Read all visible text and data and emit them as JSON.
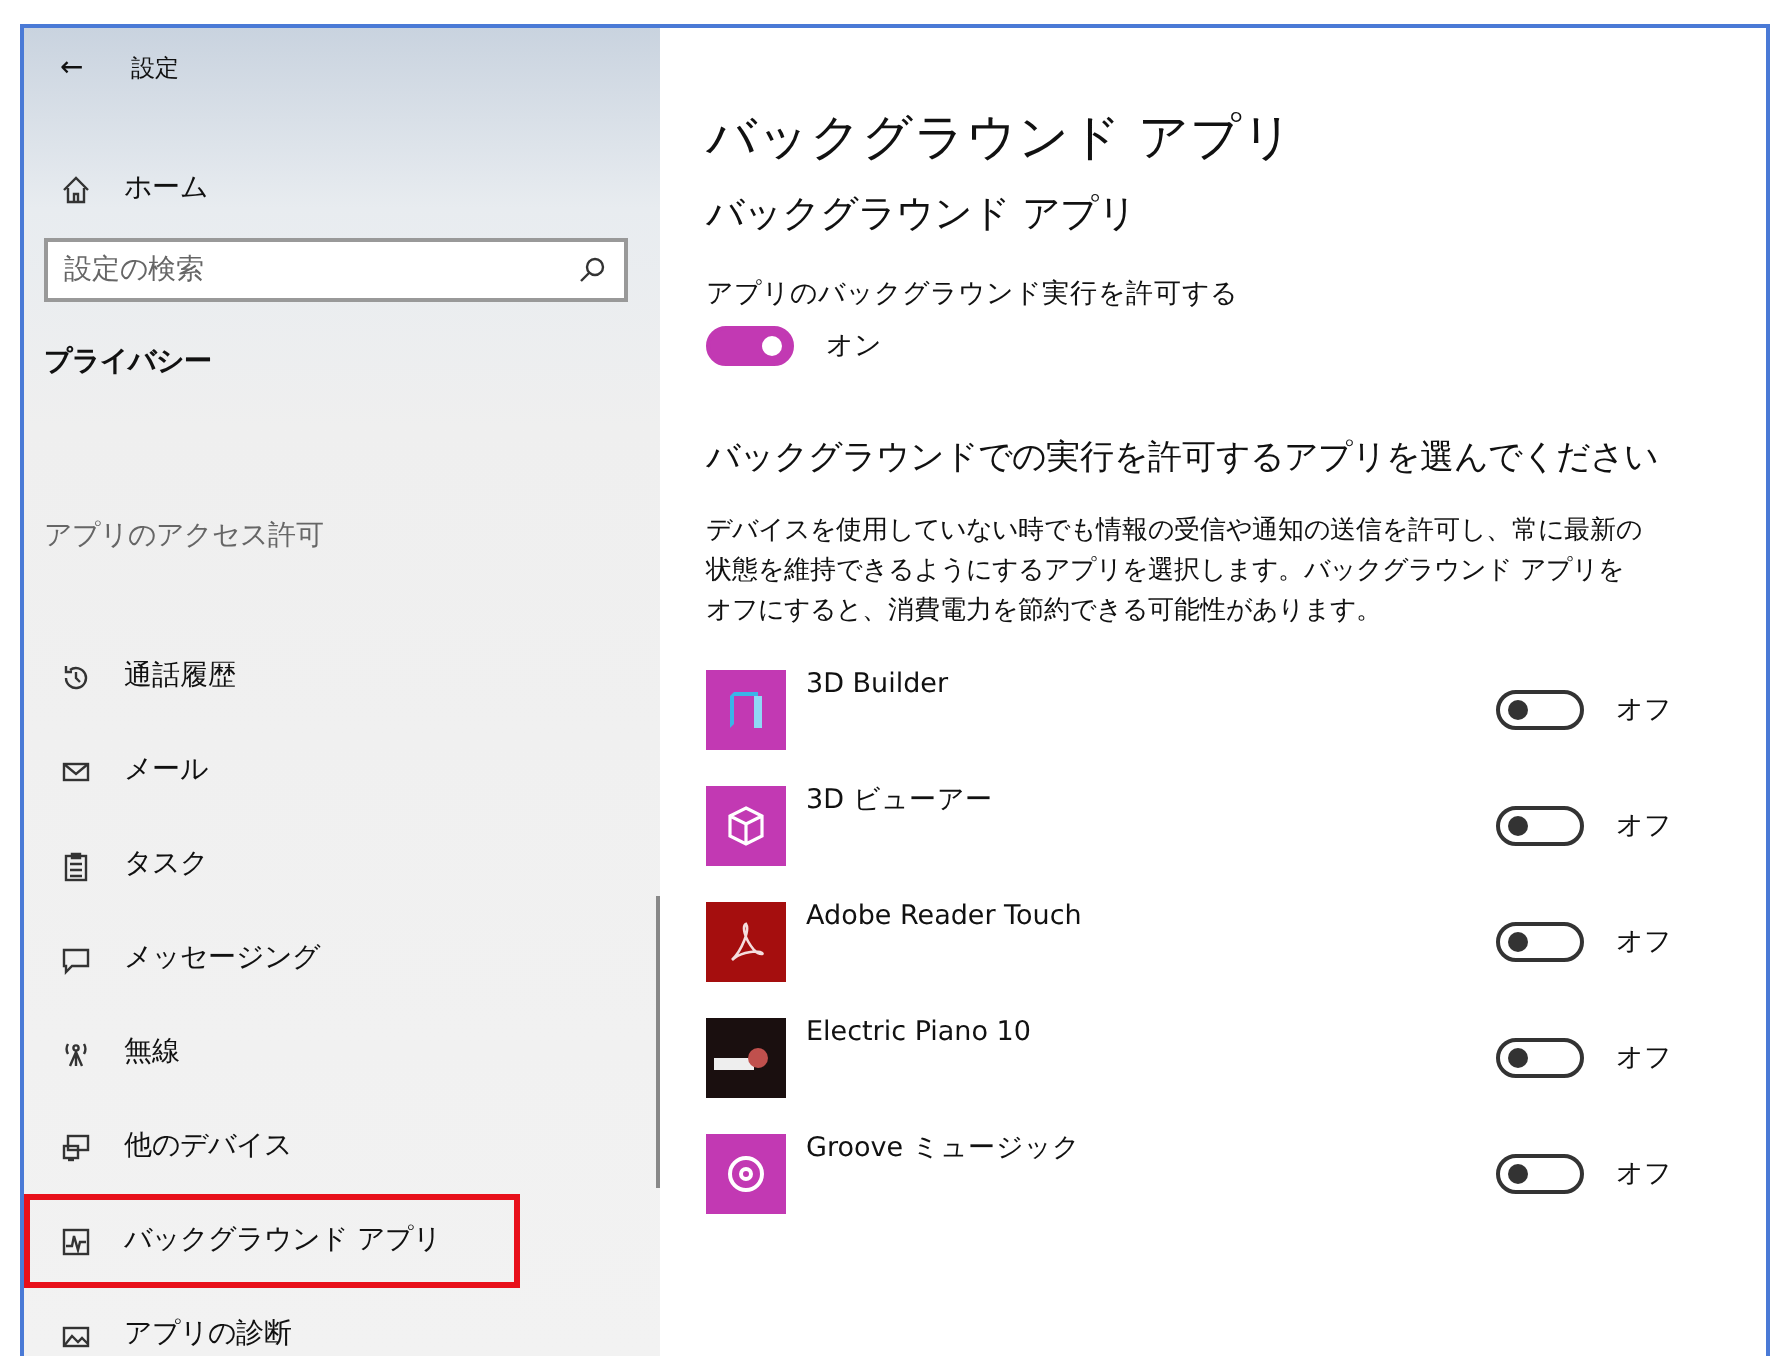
{
  "window": {
    "title": "設定",
    "back": "←"
  },
  "sidebar": {
    "home": "ホーム",
    "search": {
      "placeholder": "設定の検索"
    },
    "category": "プライバシー",
    "group_heading": "アプリのアクセス許可",
    "items": [
      {
        "label": "通話履歴",
        "highlighted": false
      },
      {
        "label": "メール",
        "highlighted": false
      },
      {
        "label": "タスク",
        "highlighted": false
      },
      {
        "label": "メッセージング",
        "highlighted": false
      },
      {
        "label": "無線",
        "highlighted": false
      },
      {
        "label": "他のデバイス",
        "highlighted": false
      },
      {
        "label": "バックグラウンド アプリ",
        "highlighted": true
      },
      {
        "label": "アプリの診断",
        "highlighted": false
      }
    ]
  },
  "content": {
    "title": "バックグラウンド アプリ",
    "subtitle": "バックグラウンド アプリ",
    "master": {
      "label": "アプリのバックグラウンド実行を許可する",
      "on": true,
      "state": "オン"
    },
    "section_heading": "バックグラウンドでの実行を許可するアプリを選んでください",
    "description": "デバイスを使用していない時でも情報の受信や通知の送信を許可し、常に最新の状態を維持できるようにするアプリを選択します。バックグラウンド アプリをオフにすると、消費電力を節約できる可能性があります。",
    "apps": [
      {
        "name": "3D Builder",
        "color": "#c239b3",
        "on": false,
        "state": "オフ"
      },
      {
        "name": "3D ビューアー",
        "color": "#c239b3",
        "on": false,
        "state": "オフ"
      },
      {
        "name": "Adobe Reader Touch",
        "color": "#a50e0e",
        "on": false,
        "state": "オフ"
      },
      {
        "name": "Electric Piano 10",
        "color": "#1a0f0f",
        "on": false,
        "state": "オフ"
      },
      {
        "name": "Groove ミュージック",
        "color": "#c239b3",
        "on": false,
        "state": "オフ"
      }
    ]
  }
}
